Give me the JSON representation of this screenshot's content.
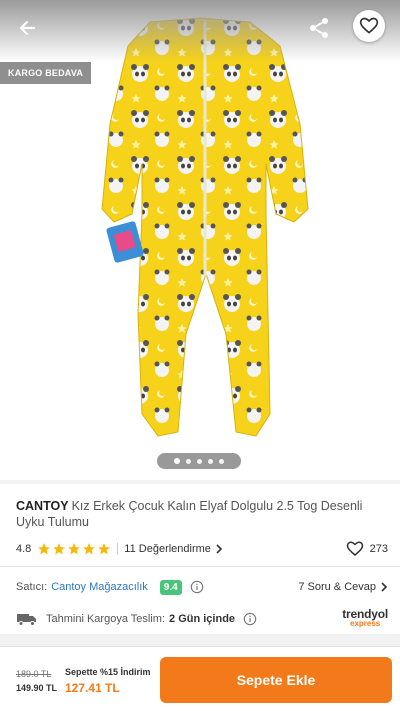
{
  "badge": "KARGO BEDAVA",
  "icons": {
    "back": "back-arrow-icon",
    "share": "share-icon",
    "favorite": "heart-icon"
  },
  "gallery": {
    "image_alt": "Yellow panda-patterned baby sleep suit",
    "dot_count": 5,
    "active_dot": 0
  },
  "product": {
    "brand": "CANTOY",
    "title": "Kız Erkek Çocuk Kalın Elyaf Dolgulu 2.5 Tog Desenli Uyku Tulumu",
    "rating": "4.8",
    "stars": 5,
    "reviews": "11 Değerlendirme",
    "likes": "273"
  },
  "seller": {
    "label": "Satıcı:",
    "name": "Cantoy Mağazacılık",
    "score": "9.4",
    "qa": "7 Soru & Cevap"
  },
  "shipping": {
    "label": "Tahmini Kargoya Teslim:",
    "value": "2 Gün içinde",
    "logo_top": "trendyol",
    "logo_bottom": "express"
  },
  "bottom": {
    "old_price": "189.0 TL",
    "price": "149.90 TL",
    "promo": "Sepette %15 İndirim",
    "promo_price": "127.41 TL",
    "cta": "Sepete Ekle"
  },
  "colors": {
    "accent": "#f27a1a",
    "seller": "#2b79c2",
    "score": "#4cc37a",
    "star": "#f9b707",
    "suit": "#f6d21a"
  }
}
